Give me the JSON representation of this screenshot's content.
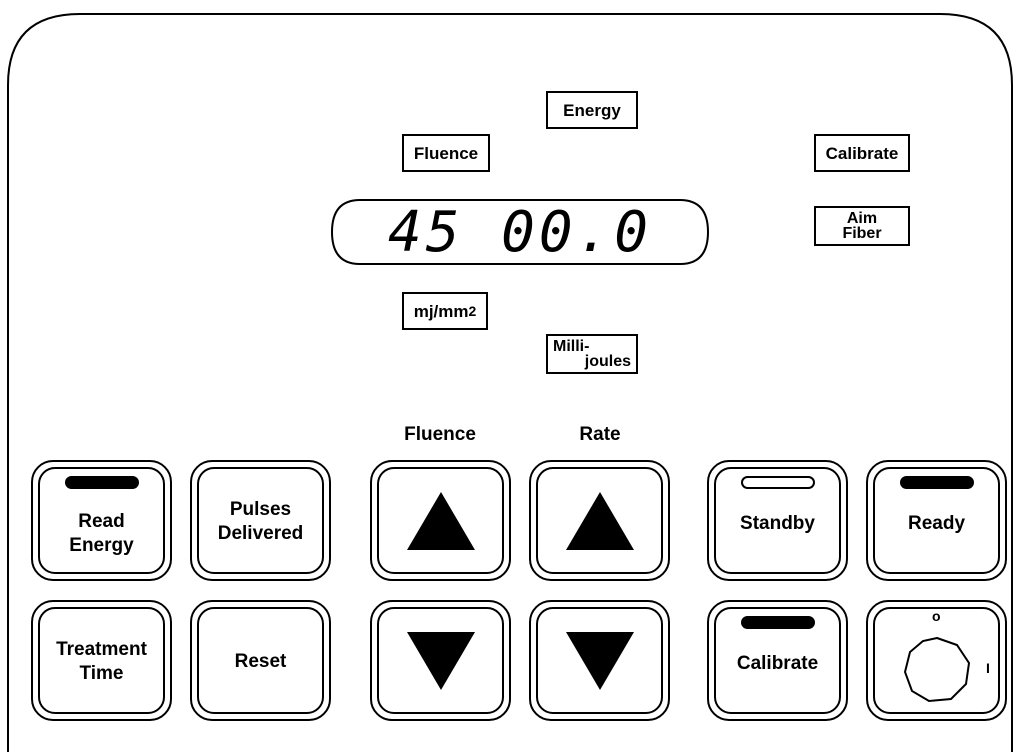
{
  "panel": {
    "display": {
      "readout": "45 00.0"
    },
    "indicators": {
      "energy": "Energy",
      "fluence": "Fluence",
      "calibrate": "Calibrate",
      "aim_fiber_line1": "Aim",
      "aim_fiber_line2": "Fiber",
      "unit_mj_mm": "mj/mm",
      "unit_mj_mm_sup": "2",
      "millijoules_line1": "Milli-",
      "millijoules_line2": "joules"
    },
    "column_labels": {
      "fluence": "Fluence",
      "rate": "Rate"
    },
    "buttons": {
      "read_energy_line1": "Read",
      "read_energy_line2": "Energy",
      "pulses_delivered_line1": "Pulses",
      "pulses_delivered_line2": "Delivered",
      "standby": "Standby",
      "ready": "Ready",
      "treatment_time_line1": "Treatment",
      "treatment_time_line2": "Time",
      "reset": "Reset",
      "calibrate": "Calibrate"
    },
    "leds": {
      "read_energy": "on",
      "standby": "off",
      "ready": "on",
      "calibrate": "on"
    },
    "power_switch": {
      "off_mark": "o",
      "on_mark": "I"
    },
    "icons": {
      "fluence_up": "triangle-up-icon",
      "fluence_down": "triangle-down-icon",
      "rate_up": "triangle-up-icon",
      "rate_down": "triangle-down-icon",
      "power": "power-knob-icon"
    },
    "colors": {
      "ink": "#000000",
      "background": "#ffffff"
    }
  }
}
